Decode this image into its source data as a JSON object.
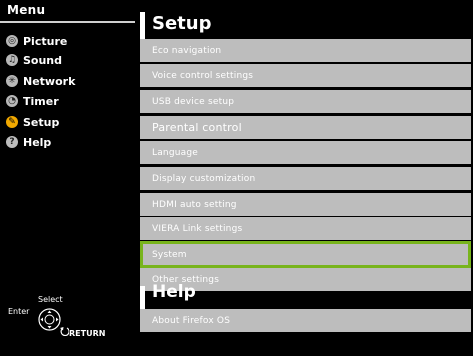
{
  "menu": {
    "title": "Menu",
    "items": [
      {
        "label": "Picture",
        "icon": "picture-icon",
        "glyph": "◎"
      },
      {
        "label": "Sound",
        "icon": "sound-icon",
        "glyph": "♫"
      },
      {
        "label": "Network",
        "icon": "network-icon",
        "glyph": "✳"
      },
      {
        "label": "Timer",
        "icon": "timer-icon",
        "glyph": "◔"
      },
      {
        "label": "Setup",
        "icon": "setup-icon",
        "glyph": "✎"
      },
      {
        "label": "Help",
        "icon": "help-icon",
        "glyph": "?"
      }
    ]
  },
  "remote_hint": {
    "select": "Select",
    "enter": "Enter",
    "return": "RETURN"
  },
  "setup": {
    "title": "Setup",
    "items": [
      "Eco navigation",
      "Voice control settings",
      "USB device setup",
      "Parental control",
      "Language",
      "Display customization",
      "HDMI auto setting",
      "VIERA Link settings",
      "System",
      "Other settings"
    ],
    "selected_index": 8
  },
  "help": {
    "title": "Help",
    "items": [
      "About Firefox OS"
    ]
  },
  "colors": {
    "background": "#000000",
    "item_background": "#bdbdbd",
    "selection_border": "#78b41c",
    "active_icon": "#f2a900"
  }
}
